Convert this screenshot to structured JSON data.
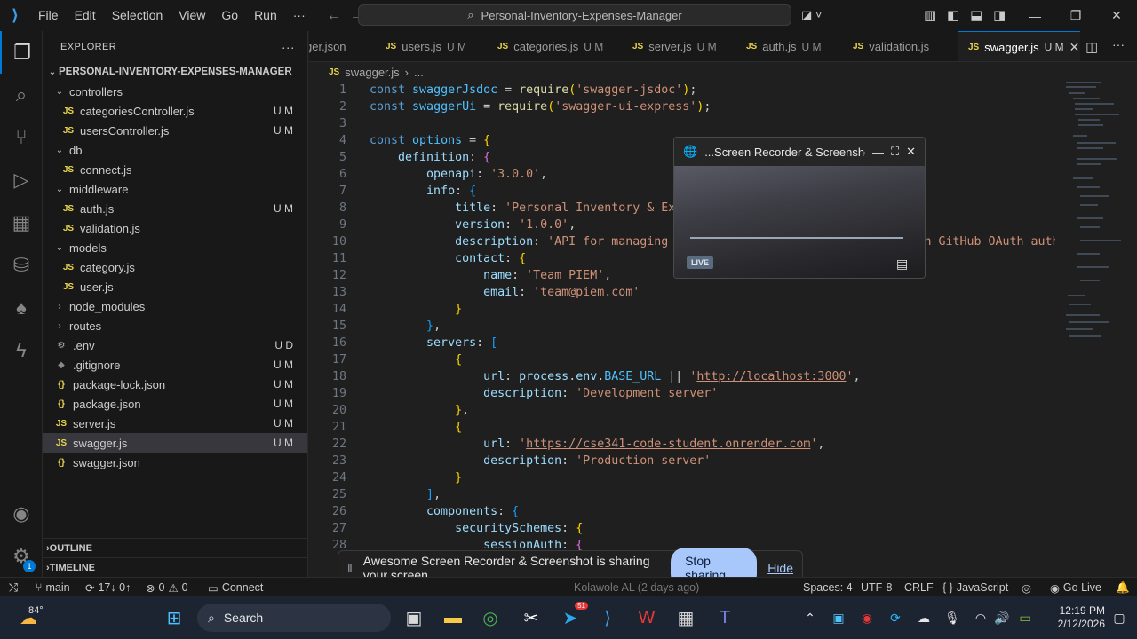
{
  "titlebar": {
    "menus": [
      "File",
      "Edit",
      "Selection",
      "View",
      "Go",
      "Run",
      "···"
    ],
    "search": "Personal-Inventory-Expenses-Manager"
  },
  "sidebar": {
    "title": "EXPLORER",
    "project": "PERSONAL-INVENTORY-EXPENSES-MANAGER",
    "items": [
      {
        "label": "controllers",
        "type": "folder",
        "open": true,
        "status": ""
      },
      {
        "label": "categoriesController.js",
        "type": "js",
        "status": "U M"
      },
      {
        "label": "usersController.js",
        "type": "js",
        "status": "U M"
      },
      {
        "label": "db",
        "type": "folder",
        "open": true,
        "status": ""
      },
      {
        "label": "connect.js",
        "type": "js",
        "status": ""
      },
      {
        "label": "middleware",
        "type": "folder",
        "open": true,
        "status": ""
      },
      {
        "label": "auth.js",
        "type": "js",
        "status": "U M"
      },
      {
        "label": "validation.js",
        "type": "js",
        "status": ""
      },
      {
        "label": "models",
        "type": "folder",
        "open": true,
        "status": ""
      },
      {
        "label": "category.js",
        "type": "js",
        "status": ""
      },
      {
        "label": "user.js",
        "type": "js",
        "status": ""
      },
      {
        "label": "node_modules",
        "type": "folder",
        "open": false,
        "status": ""
      },
      {
        "label": "routes",
        "type": "folder",
        "open": false,
        "status": ""
      },
      {
        "label": ".env",
        "type": "env",
        "status": "U D"
      },
      {
        "label": ".gitignore",
        "type": "git",
        "status": "U M"
      },
      {
        "label": "package-lock.json",
        "type": "json",
        "status": "U M"
      },
      {
        "label": "package.json",
        "type": "json",
        "status": "U M"
      },
      {
        "label": "server.js",
        "type": "js",
        "status": "U M"
      },
      {
        "label": "swagger.js",
        "type": "js",
        "status": "U M"
      },
      {
        "label": "swagger.json",
        "type": "json",
        "status": ""
      }
    ],
    "outline": "OUTLINE",
    "timeline": "TIMELINE"
  },
  "tabs": [
    {
      "label": "ger.json",
      "mod": ""
    },
    {
      "label": "users.js",
      "mod": "U M"
    },
    {
      "label": "categories.js",
      "mod": "U M"
    },
    {
      "label": "server.js",
      "mod": "U M"
    },
    {
      "label": "auth.js",
      "mod": "U M"
    },
    {
      "label": "validation.js",
      "mod": ""
    },
    {
      "label": "swagger.js",
      "mod": "U M"
    }
  ],
  "breadcrumb": {
    "file": "swagger.js",
    "more": "..."
  },
  "recorder": {
    "title": "...Screen Recorder & Screenshot",
    "live": "LIVE"
  },
  "sharebar": {
    "message": "Awesome Screen Recorder & Screenshot is sharing your screen.",
    "stop": "Stop sharing",
    "hide": "Hide"
  },
  "statusbar": {
    "branch": "main",
    "sync": "17↓ 0↑",
    "problems": "0",
    "warnings": "0",
    "connect": "Connect",
    "blame": "Kolawole AL (2 days ago)",
    "spaces": "Spaces: 4",
    "encoding": "UTF-8",
    "eol": "CRLF",
    "language": "JavaScript",
    "golive": "Go Live"
  },
  "taskbar": {
    "weather": "84°",
    "search": "Search",
    "time": "12:19 PM",
    "date": "2/12/2026",
    "telegram_badge": "51"
  },
  "activity_badge": "1"
}
